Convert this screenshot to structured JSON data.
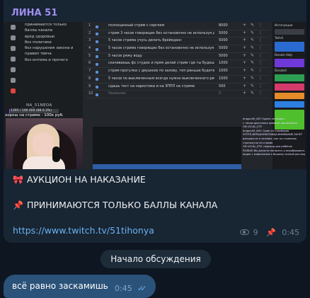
{
  "post": {
    "author": "ЛИНА 51",
    "stream_screenshot": {
      "sidebar_items": [
        "принимаются только",
        "баллы канала",
        "вред здоровью",
        "без политики",
        "без нарушения закона и",
        "правил твича",
        "без интима и прочего"
      ],
      "streamer_tag": "NA_51NEDA",
      "progress_text": "1395 / 100 000 (88 0.3%)",
      "progress_fraction": 0.014,
      "caption": "хорош на стриме - 100к руб.",
      "rows": [
        {
          "num": "1",
          "text": "полноценный стрим с сергеем",
          "points": "8000"
        },
        {
          "num": "2",
          "text": "стрим 3 часов говорящих без остановочно не используя других сл",
          "points": "5000"
        },
        {
          "num": "3",
          "text": "5 часов стрима учусь делать брейкданс",
          "points": "5000"
        },
        {
          "num": "4",
          "text": "5 часов стрима говорящих без остановочно не используя других сл",
          "points": "5000"
        },
        {
          "num": "5",
          "text": "5 часов ряжу воду",
          "points": "5000"
        },
        {
          "num": "6",
          "text": "скачиваешь фс студио и прям делай стрим где ты будешь тупаря",
          "points": "1000"
        },
        {
          "num": "7",
          "text": "стрим прогулка с двушкою по залову, тип раньше будете по гули",
          "points": "1000"
        },
        {
          "num": "8",
          "text": "5 часов по выключенным всегда нужно выключенного ребёнка с",
          "points": "1000"
        },
        {
          "num": "9",
          "text": "сдашь тест на наркотики и на ЗППП на стриме",
          "points": "500"
        },
        {
          "num": "10",
          "text": "Название",
          "points": "0"
        }
      ],
      "right_panel_labels": [
        "Интеграции",
        "Twitch",
        "Donate Help",
        "Donatell"
      ],
      "chat_lines": [
        "dragon49_AYO Одино он решил",
        "с таком драгоняил девочки шипилились",
        "ON LOCAL_ETE",
        "dragon49_AYO: Один из стримеров",
        "ЭТПТП,ВНРЦНАРАКТИЙЦА-ВНИМАНИЕ-ЗАЧЕТ",
        "раскрасьте в человек, как ты стрипишь",
        "стрельнуло на стриме",
        "ON LOCAL_ETE: переход для ребёнок",
        "РАЗБАН Вы должны написать и апробировать",
        "видео с извинением к Вашему полной растворе"
      ]
    },
    "lines": [
      {
        "icon": "🎀",
        "text": "АУКЦИОН НА НАКАЗАНИЕ"
      },
      {
        "icon": "📌",
        "text": "ПРИНИМАЮТСЯ ТОЛЬКО БАЛЛЫ КАНАЛА"
      }
    ],
    "link": "https://www.twitch.tv/51tihonya",
    "views": "9",
    "time": "0:45"
  },
  "discussion_label": "Начало обсуждения",
  "reply": {
    "text": "всё равно заскамишь",
    "time": "0:45"
  }
}
